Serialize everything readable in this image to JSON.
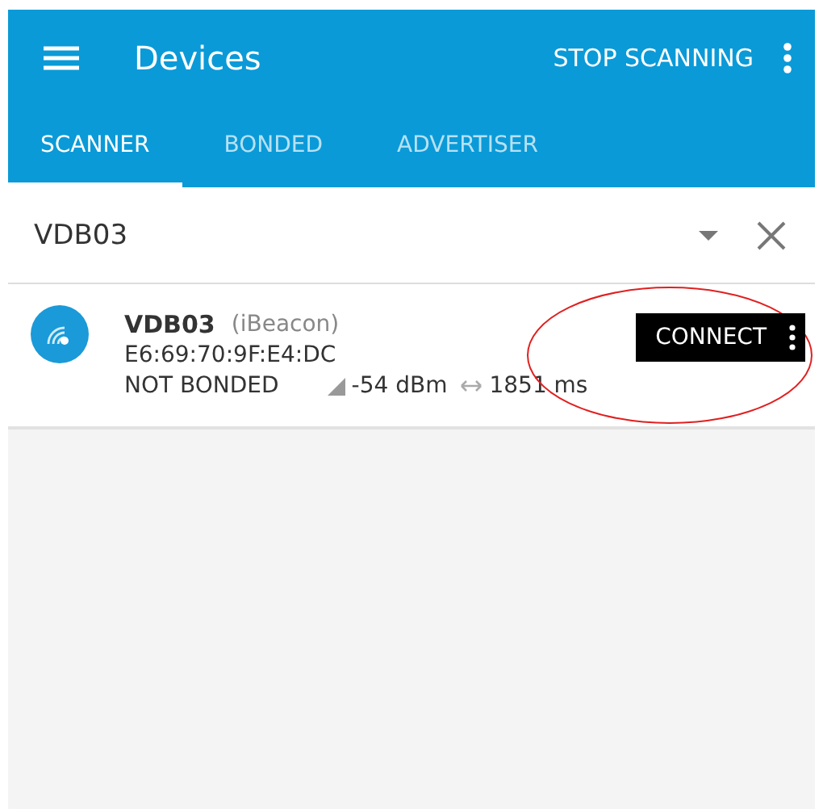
{
  "toolbar": {
    "title": "Devices",
    "action": "STOP SCANNING"
  },
  "tabs": [
    {
      "label": "SCANNER",
      "selected": true
    },
    {
      "label": "BONDED",
      "selected": false
    },
    {
      "label": "ADVERTISER",
      "selected": false
    }
  ],
  "filter": {
    "value": "VDB03"
  },
  "devices": [
    {
      "name": "VDB03",
      "type": "(iBeacon)",
      "address": "E6:69:70:9F:E4:DC",
      "bond_state": "NOT BONDED",
      "rssi": "-54 dBm",
      "interval": "1851 ms",
      "button": "CONNECT",
      "highlighted": true
    }
  ]
}
